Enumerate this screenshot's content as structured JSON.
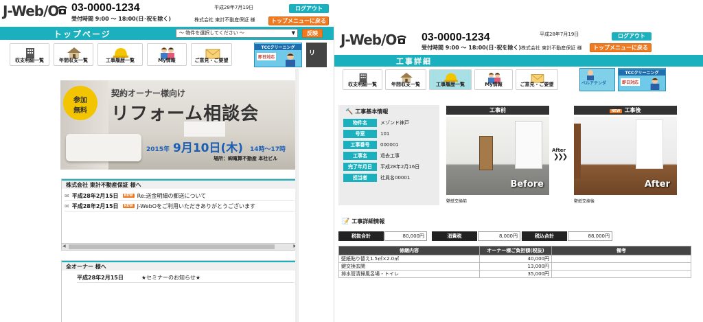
{
  "left": {
    "header": {
      "logo_main": "J-Web/O",
      "phone": "03-0000-1234",
      "hours": "受付時間 9:00 ～ 18:00(日･祝を除く)",
      "date": "平成28年7月19日",
      "company": "株式会社 東計不動産保証 様",
      "logout_label": "ログアウト",
      "top_menu_label": "トップメニューに戻る"
    },
    "title_bar": {
      "title": "トップページ",
      "property_select": "～ 物件を選択してください ～",
      "reflect_label": "反映"
    },
    "nav": [
      {
        "label": "収支明細一覧"
      },
      {
        "label": "年間収支一覧"
      },
      {
        "label": "工事履歴一覧"
      },
      {
        "label": "My情報"
      },
      {
        "label": "ご意見・ご要望"
      }
    ],
    "side_banner": {
      "line1": "TCCクリーニング",
      "line2": "即日対応"
    },
    "hero": {
      "badge_line1": "参加",
      "badge_line2": "無料",
      "subtitle": "契約オーナー様向け",
      "title": "リフォーム相談会",
      "date_year": "2015年",
      "date_main": "9月10日(木)",
      "time": "14時～17時",
      "place": "場所：㈱電算不動産 本社ビル"
    },
    "notice_panel": {
      "header": "株式会社 東計不動産保証 様へ",
      "items": [
        {
          "date": "平成28年2月15日",
          "new": "NEW",
          "text": "Re:送金明細の郵送について"
        },
        {
          "date": "平成28年2月15日",
          "new": "NEW",
          "text": "J-WebOをご利用いただきありがとうございます"
        }
      ]
    },
    "all_owner_panel": {
      "header": "全オーナー 様へ",
      "items": [
        {
          "date": "平成28年2月15日",
          "text": "★セミナーのお知らせ★"
        }
      ]
    }
  },
  "right": {
    "header": {
      "logo_main": "J-Web/O",
      "phone": "03-0000-1234",
      "hours": "受付時間 9:00 ～ 18:00(日･祝を除く)",
      "date": "平成28年7月19日",
      "company": "株式会社 東計不動産保証 様",
      "logout_label": "ログアウト",
      "top_menu_label": "トップメニューに戻る"
    },
    "title_bar": {
      "title": "工事詳細"
    },
    "nav": [
      {
        "label": "収支明細一覧"
      },
      {
        "label": "年間収支一覧"
      },
      {
        "label": "工事履歴一覧"
      },
      {
        "label": "My情報"
      },
      {
        "label": "ご意見・ご要望"
      }
    ],
    "side_banner": {
      "line1": "TCCクリーニング",
      "line2": "即日対応",
      "line3": "ベルアテンダ"
    },
    "basic_info": {
      "heading": "工事基本情報",
      "fields": [
        {
          "label": "物件名",
          "value": "メゾンド神戸"
        },
        {
          "label": "号室",
          "value": "101"
        },
        {
          "label": "工事番号",
          "value": "000001"
        },
        {
          "label": "工事名",
          "value": "退去工事"
        },
        {
          "label": "完了年月日",
          "value": "平成28年2月16日"
        },
        {
          "label": "担当者",
          "value": "社員名00001"
        }
      ]
    },
    "before": {
      "heading": "工事前",
      "overlay": "Before",
      "caption": "壁紙交換前"
    },
    "arrow_label": "After",
    "after": {
      "new": "NEW",
      "heading": "工事後",
      "overlay": "After",
      "caption": "壁紙交換後"
    },
    "detail": {
      "heading": "工事詳細情報",
      "subtotal_label": "税抜合計",
      "subtotal_value": "80,000円",
      "tax_label": "消費税",
      "tax_value": "8,000円",
      "total_label": "税込合計",
      "total_value": "88,000円",
      "columns": [
        "修繕内容",
        "オーナー様ご負担額(税抜)",
        "備考"
      ],
      "rows": [
        {
          "item": "壁紙貼り替え1.5㎡×2.0㎡",
          "amount": "40,000円",
          "note": ""
        },
        {
          "item": "鍵交換玄関",
          "amount": "13,000円",
          "note": ""
        },
        {
          "item": "排水管清掃風呂場・トイレ",
          "amount": "35,000円",
          "note": ""
        }
      ]
    }
  },
  "colors": {
    "teal": "#1ab0bd",
    "orange": "#f07a22",
    "dark": "#333333"
  }
}
